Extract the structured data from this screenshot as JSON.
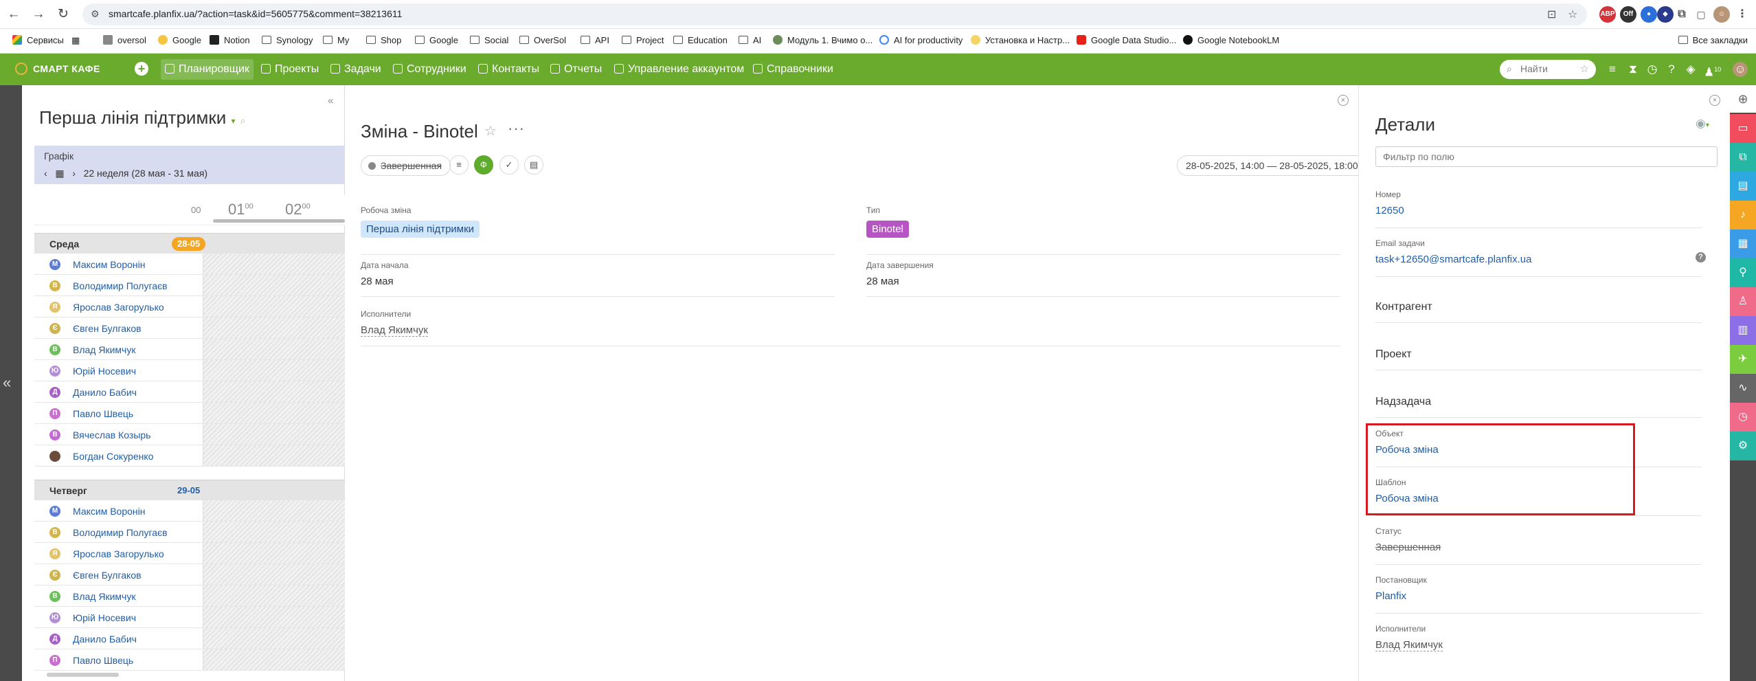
{
  "browser": {
    "url": "smartcafe.planfix.ua/?action=task&id=5605775&comment=38213611",
    "bookmarks": [
      "Сервисы",
      "oversol",
      "Google",
      "Notion",
      "Synology",
      "My",
      "Shop",
      "Google",
      "Social",
      "OverSol",
      "API",
      "Project",
      "Education",
      "AI",
      "Модуль 1. Вчимо о...",
      "AI for productivity",
      "Установка и Настр...",
      "Google Data Studio...",
      "Google NotebookLM"
    ],
    "bookmarks_right": "Все закладки"
  },
  "app": {
    "logo": "СМАРТ КАФЕ",
    "menu": [
      "Планировщик",
      "Проекты",
      "Задачи",
      "Сотрудники",
      "Контакты",
      "Отчеты",
      "Управление аккаунтом",
      "Справочники"
    ],
    "search_placeholder": "Найти",
    "notif_count": "10",
    "colors": {
      "header": "#6aab2e",
      "highlight": "#d71920"
    }
  },
  "planner": {
    "title": "Перша лінія підтримки",
    "graph_label": "Графік",
    "week": "22 неделя (28 мая - 31 мая)",
    "times": [
      "00",
      "01",
      "02"
    ],
    "days": [
      {
        "name": "Среда",
        "date": "28-05",
        "people": [
          {
            "initial": "М",
            "name": "Максим Воронін",
            "color": "#5b7bd5"
          },
          {
            "initial": "В",
            "name": "Володимир Полугаєв",
            "color": "#d4b54a"
          },
          {
            "initial": "Я",
            "name": "Ярослав Загорулько",
            "color": "#e3c26a"
          },
          {
            "initial": "Є",
            "name": "Євген Булгаков",
            "color": "#cfb34e"
          },
          {
            "initial": "В",
            "name": "Влад Якимчук",
            "color": "#6cc05b"
          },
          {
            "initial": "Ю",
            "name": "Юрій Носевич",
            "color": "#b48ed6"
          },
          {
            "initial": "Д",
            "name": "Данило Бабич",
            "color": "#a65fc7"
          },
          {
            "initial": "П",
            "name": "Павло Швець",
            "color": "#c86fd0"
          },
          {
            "initial": "В",
            "name": "Вячеслав Козырь",
            "color": "#c36ad4"
          },
          {
            "initial": "",
            "name": "Богдан Сокуренко",
            "color": "#6b4b3a"
          }
        ]
      },
      {
        "name": "Четверг",
        "date": "29-05",
        "people": [
          {
            "initial": "М",
            "name": "Максим Воронін",
            "color": "#5b7bd5"
          },
          {
            "initial": "В",
            "name": "Володимир Полугаєв",
            "color": "#d4b54a"
          },
          {
            "initial": "Я",
            "name": "Ярослав Загорулько",
            "color": "#e3c26a"
          },
          {
            "initial": "Є",
            "name": "Євген Булгаков",
            "color": "#cfb34e"
          },
          {
            "initial": "В",
            "name": "Влад Якимчук",
            "color": "#6cc05b"
          },
          {
            "initial": "Ю",
            "name": "Юрій Носевич",
            "color": "#b48ed6"
          },
          {
            "initial": "Д",
            "name": "Данило Бабич",
            "color": "#a65fc7"
          },
          {
            "initial": "П",
            "name": "Павло Швець",
            "color": "#c86fd0"
          }
        ]
      }
    ]
  },
  "task": {
    "title": "Зміна - Binotel",
    "status": "Завершенная",
    "date_range": "28-05-2025, 14:00 — 28-05-2025, 18:00",
    "fields": {
      "shift_label": "Робоча зміна",
      "shift_value": "Перша лінія підтримки",
      "type_label": "Тип",
      "type_value": "Binotel",
      "start_label": "Дата начала",
      "start_value": "28 мая",
      "end_label": "Дата завершения",
      "end_value": "28 мая",
      "assignees_label": "Исполнители",
      "assignees_value": "Влад Якимчук"
    }
  },
  "details": {
    "title": "Детали",
    "filter_placeholder": "Фильтр по полю",
    "number_label": "Номер",
    "number_value": "12650",
    "email_label": "Email задачи",
    "email_value": "task+12650@smartcafe.planfix.ua",
    "contractor": "Контрагент",
    "project": "Проект",
    "parent": "Надзадача",
    "object_label": "Объект",
    "object_value": "Робоча зміна",
    "template_label": "Шаблон",
    "template_value": "Робоча зміна",
    "status_label": "Статус",
    "status_value": "Завершенная",
    "assigner_label": "Постановщик",
    "assigner_value": "Planfix",
    "executors_label": "Исполнители",
    "executors_value": "Влад Якимчук"
  },
  "stripe_colors": [
    "#f24d5c",
    "#26b7a4",
    "#2ea8e0",
    "#f5a623",
    "#3a9be6",
    "#1fb7a6",
    "#f06b8a",
    "#8c6fe6",
    "#7ccc3f",
    "#666666",
    "#f06b8a",
    "#26b7a4"
  ]
}
